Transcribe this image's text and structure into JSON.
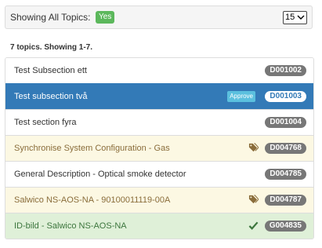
{
  "header": {
    "showing_label": "Showing All Topics:",
    "yes_badge": "Yes",
    "per_page_value": "15"
  },
  "summary": "7 topics. Showing 1-7.",
  "topics": [
    {
      "title": "Test Subsection ett",
      "code": "D001002",
      "state": "default"
    },
    {
      "title": "Test subsection två",
      "code": "D001003",
      "state": "active",
      "approve_label": "Approve"
    },
    {
      "title": "Test section fyra",
      "code": "D001004",
      "state": "default"
    },
    {
      "title": "Synchronise System Configuration - Gas",
      "code": "D004768",
      "state": "warning",
      "icon": "tags-icon"
    },
    {
      "title": "General Description - Optical smoke detector",
      "code": "D004785",
      "state": "default"
    },
    {
      "title": "Salwico NS-AOS-NA - 90100011119-00A",
      "code": "D004787",
      "state": "warning",
      "icon": "tags-icon"
    },
    {
      "title": "ID-bild - Salwico NS-AOS-NA",
      "code": "G004835",
      "state": "success",
      "icon": "check-icon"
    }
  ],
  "colors": {
    "active": "#337ab7",
    "warning_bg": "#fcf8e3",
    "success_bg": "#dff0d8",
    "badge_default": "#777777",
    "yes_green": "#5cb85c",
    "approve_blue": "#5bc0de"
  }
}
